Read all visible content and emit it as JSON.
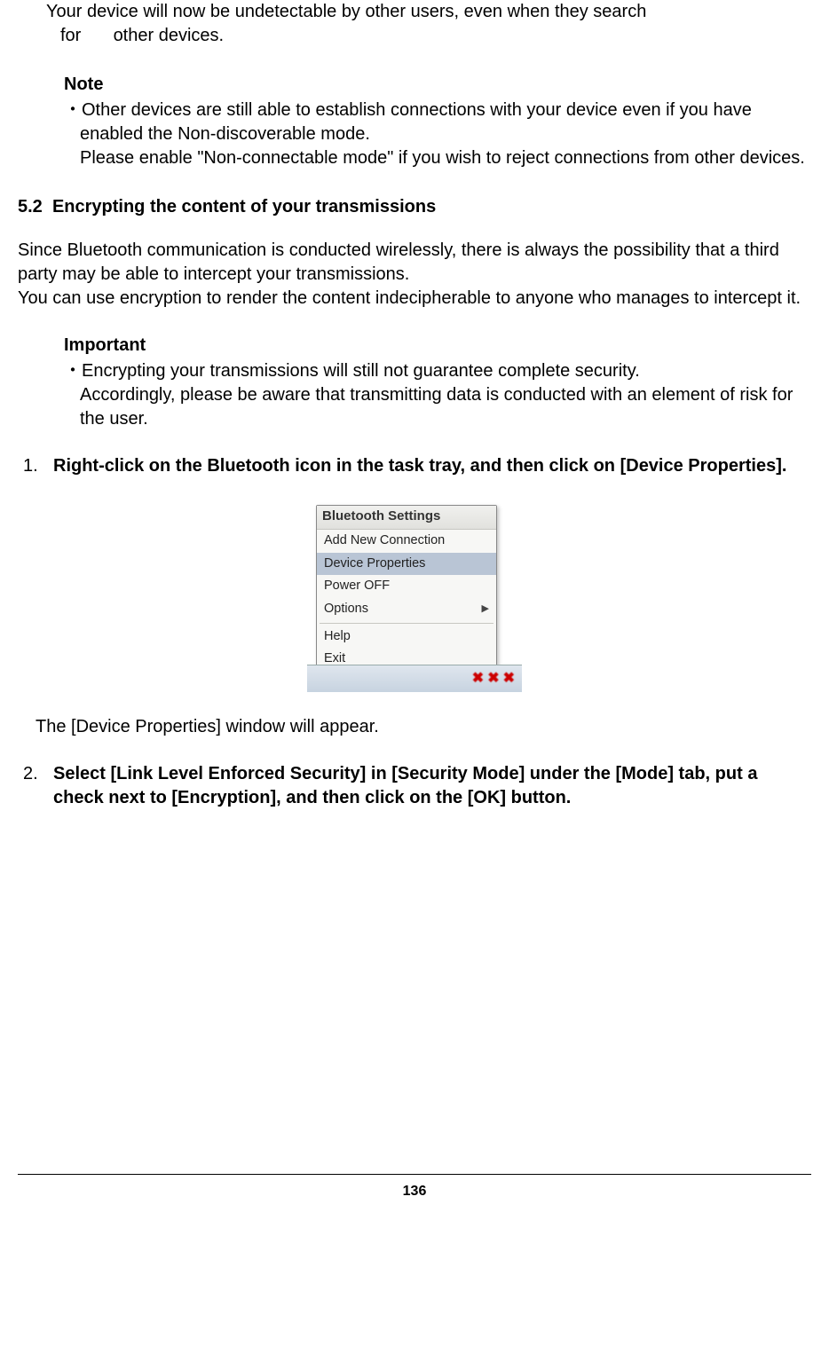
{
  "intro": {
    "line1": "Your device will now be undetectable by other users, even when they search",
    "for_label": "for",
    "line2_rest": "other devices."
  },
  "note": {
    "heading": "Note",
    "bullet_marker": "・",
    "para1": "Other devices are still able to establish connections with your device even if you  have enabled the Non-discoverable mode.",
    "para2": "Please enable \"Non-connectable mode\" if you wish to reject connections from    other devices."
  },
  "section": {
    "number": "5.2",
    "title": "Encrypting the content of your transmissions"
  },
  "body": {
    "para1": "Since Bluetooth communication is conducted wirelessly, there is always the possibility that a third party may be able to intercept your transmissions.",
    "para2": "You can use encryption to render the content indecipherable to anyone who manages to intercept it."
  },
  "important": {
    "heading": "Important",
    "bullet_marker": "・",
    "text": "Encrypting your transmissions will still not guarantee complete security.\nAccordingly, please be aware that transmitting data is conducted with an element of risk for the user."
  },
  "steps": [
    {
      "num": "1.",
      "text": "Right-click on the Bluetooth icon in the task tray, and then click on [Device Properties]."
    },
    {
      "num": "2.",
      "text": "Select [Link Level Enforced Security] in [Security Mode] under the [Mode] tab, put a check next to [Encryption], and then click on the [OK] button."
    }
  ],
  "menu": {
    "title": "Bluetooth Settings",
    "items": [
      {
        "label": "Add New Connection",
        "selected": false,
        "has_submenu": false
      },
      {
        "label": "Device Properties",
        "selected": true,
        "has_submenu": false
      },
      {
        "label": "Power OFF",
        "selected": false,
        "has_submenu": false
      },
      {
        "label": "Options",
        "selected": false,
        "has_submenu": true
      }
    ],
    "items2": [
      {
        "label": "Help"
      },
      {
        "label": "Exit"
      }
    ]
  },
  "after_menu": "The [Device Properties] window will appear.",
  "page_number": "136"
}
